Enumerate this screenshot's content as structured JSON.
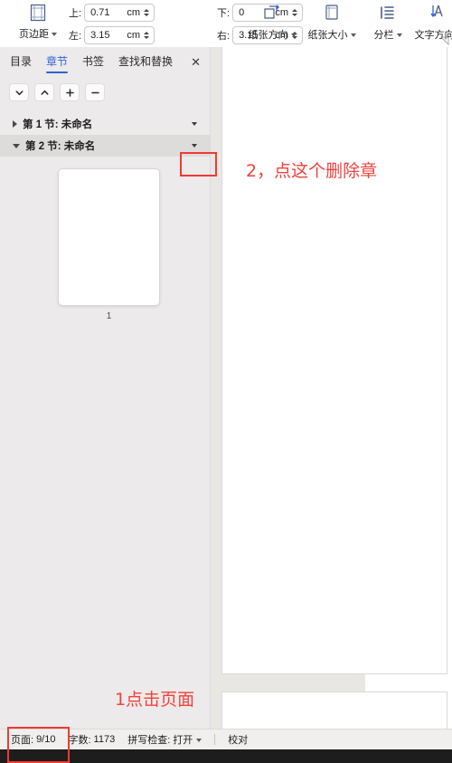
{
  "ribbon": {
    "page_setup_icon": "page-setup-grid-icon",
    "margins": {
      "label": "页边距",
      "icon": "margins-icon",
      "fields": [
        {
          "name": "top",
          "label": "上:",
          "value": "0.71",
          "unit": "cm"
        },
        {
          "name": "bottom",
          "label": "下:",
          "value": "0",
          "unit": "cm"
        },
        {
          "name": "left",
          "label": "左:",
          "value": "3.15",
          "unit": "cm"
        },
        {
          "name": "right",
          "label": "右:",
          "value": "3.15",
          "unit": "cm"
        }
      ]
    },
    "commands": [
      {
        "label": "纸张方向",
        "icon": "paper-orientation-icon"
      },
      {
        "label": "纸张大小",
        "icon": "paper-size-icon"
      },
      {
        "label": "分栏",
        "icon": "columns-icon"
      },
      {
        "label": "文字方向",
        "icon": "text-direction-icon"
      }
    ],
    "dialog_launcher_icon": "dialog-launcher-icon"
  },
  "nav_panel": {
    "tabs": [
      {
        "label": "目录",
        "active": false
      },
      {
        "label": "章节",
        "active": true
      },
      {
        "label": "书签",
        "active": false
      },
      {
        "label": "查找和替换",
        "active": false
      }
    ],
    "close_label": "✕",
    "toolbar": [
      {
        "name": "move-down-button",
        "icon": "chevron-down-icon"
      },
      {
        "name": "move-up-button",
        "icon": "chevron-up-icon"
      },
      {
        "name": "add-section-button",
        "icon": "plus-icon"
      },
      {
        "name": "remove-section-button",
        "icon": "minus-icon"
      }
    ],
    "tree": [
      {
        "label": "第 1 节: 未命名",
        "expanded": false,
        "selected": false
      },
      {
        "label": "第 2 节: 未命名",
        "expanded": true,
        "selected": true
      }
    ],
    "thumbnail": {
      "page_number": "1"
    }
  },
  "status_bar": {
    "items": [
      {
        "name": "page-indicator",
        "label": "页面:",
        "value": "9/10",
        "caret": false
      },
      {
        "name": "word-count",
        "label": "字数:",
        "value": "1173",
        "caret": false
      },
      {
        "name": "spellcheck",
        "label": "拼写检查:",
        "value": "打开",
        "caret": true
      }
    ],
    "proofread_label": "校对"
  },
  "annotations": [
    {
      "name": "annotation-delete-chapter",
      "text": "2，点这个删除章"
    },
    {
      "name": "annotation-click-page",
      "text": "1点击页面"
    }
  ],
  "colors": {
    "accent": "#2f63d8",
    "annotation_red": "#f0423c",
    "panel_bg": "#eceaea",
    "doc_bg": "#e9e7e4"
  }
}
